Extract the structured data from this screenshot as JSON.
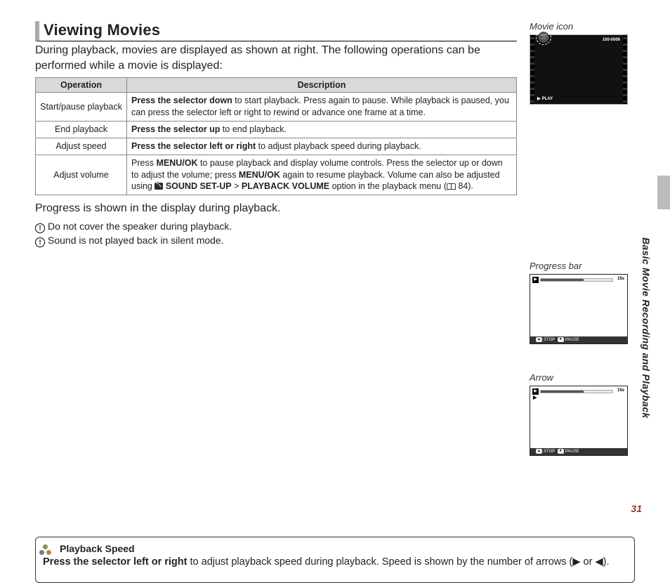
{
  "heading": "Viewing Movies",
  "intro": "During playback, movies are displayed as shown at right.  The following operations can be performed while a movie is displayed:",
  "table": {
    "headers": {
      "op": "Operation",
      "desc": "Description"
    },
    "rows": [
      {
        "op": "Start/pause playback",
        "bold": "Press the selector down",
        "rest": " to start playback.  Press again to pause.  While playback is paused, you can press the selector left or right to rewind or advance one frame at a time."
      },
      {
        "op": "End playback",
        "bold": "Press the selector up",
        "rest": " to end playback."
      },
      {
        "op": "Adjust speed",
        "bold": "Press the selector left or right",
        "rest": " to adjust playback speed during playback."
      },
      {
        "op": "Adjust volume",
        "bold_a": "MENU/OK",
        "pre": "Press ",
        "mid": " to pause playback and display volume controls.  Press the selector up or down to adjust the volume; press ",
        "bold_b": "MENU/OK",
        "post": " again to resume playback. Volume can also be adjusted using ",
        "menu1": "SOUND SET-UP",
        "gt": " > ",
        "menu2": "PLAYBACK VOLUME",
        "tail": " option in the playback menu (",
        "pageref": " 84)."
      }
    ]
  },
  "progress_line": "Progress is shown in the display during playback.",
  "notes": [
    "Do not cover the speaker during playback.",
    "Sound is not played back in silent mode."
  ],
  "box": {
    "title": "Playback Speed",
    "bold": "Press the selector left or right",
    "rest": " to adjust playback speed during playback.  Speed is shown by the number of arrows (",
    "sym1": "▶",
    "or": " or ",
    "sym2": "◀",
    "close": ")."
  },
  "right": {
    "movie_icon_label": "Movie icon",
    "movie_counter": "100-0006",
    "play_label": "PLAY",
    "progress_label": "Progress bar",
    "time": "15s",
    "stop": "STOP",
    "pause": "PAUSE",
    "arrow_label": "Arrow"
  },
  "side_text": "Basic Movie Recording and Playback",
  "page_number": "31"
}
